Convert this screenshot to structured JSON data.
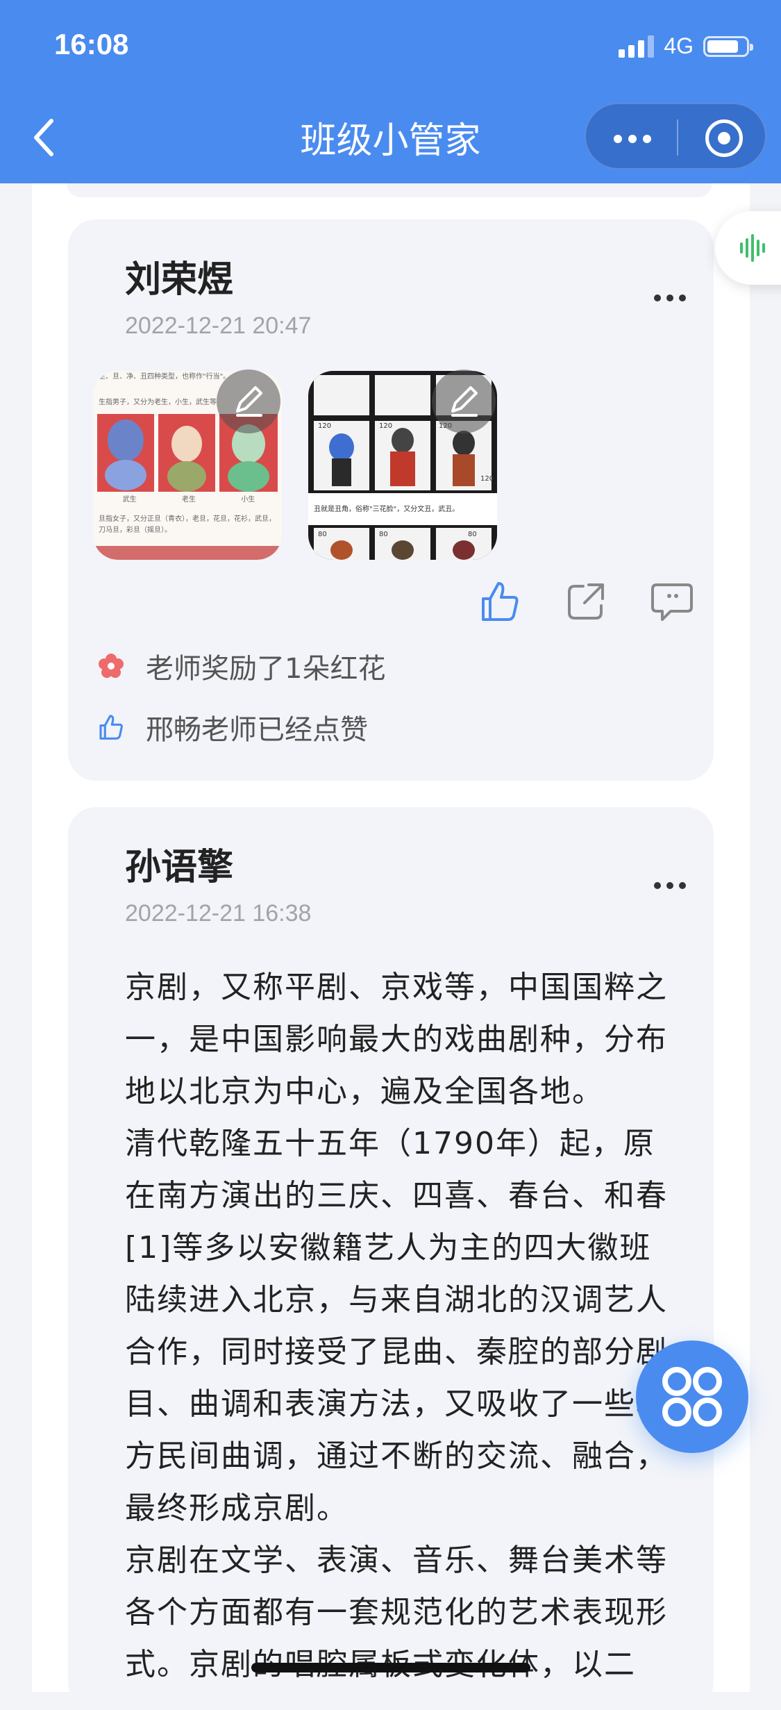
{
  "status": {
    "time": "16:08",
    "network": "4G"
  },
  "nav": {
    "title": "班级小管家"
  },
  "posts": [
    {
      "author": "刘荣煜",
      "time": "2022-12-21 20:47",
      "images": [
        {
          "caption_top": "生、旦、净、丑四种类型，也称作\"行当\"。",
          "caption_line2": "生指男子，又分为老生，小生，武生等",
          "labels": [
            "武生",
            "老生",
            "小生"
          ],
          "caption_bottom": "旦指女子，又分正旦（青衣），老旦，花旦，花衫，武旦，刀马旦，彩旦（摇旦）。"
        },
        {
          "stamp_values": [
            "120",
            "120",
            "120",
            "120",
            "80",
            "80",
            "80"
          ],
          "caption": "丑就是丑角，俗称\"三花脸\"，又分文丑，武丑。"
        }
      ],
      "reward_text": "老师奖励了1朵红花",
      "like_text": "邢畅老师已经点赞"
    },
    {
      "author": "孙语擎",
      "time": "2022-12-21 16:38",
      "paragraphs": [
        "京剧，又称平剧、京戏等，中国国粹之一，是中国影响最大的戏曲剧种，分布地以北京为中心，遍及全国各地。",
        "清代乾隆五十五年（1790年）起，原在南方演出的三庆、四喜、春台、和春[1]等多以安徽籍艺人为主的四大徽班陆续进入北京，与来自湖北的汉调艺人合作，同时接受了昆曲、秦腔的部分剧目、曲调和表演方法，又吸收了一些地方民间曲调，通过不断的交流、融合，最终形成京剧。",
        "京剧在文学、表演、音乐、舞台美术等各个方面都有一套规范化的艺术表现形式。京剧的唱腔属板式变化体，以二"
      ]
    }
  ],
  "colors": {
    "primary": "#4a8bef",
    "card_bg": "#f2f4f9",
    "flower": "#ef6b6b",
    "voice": "#3fbf6a"
  }
}
